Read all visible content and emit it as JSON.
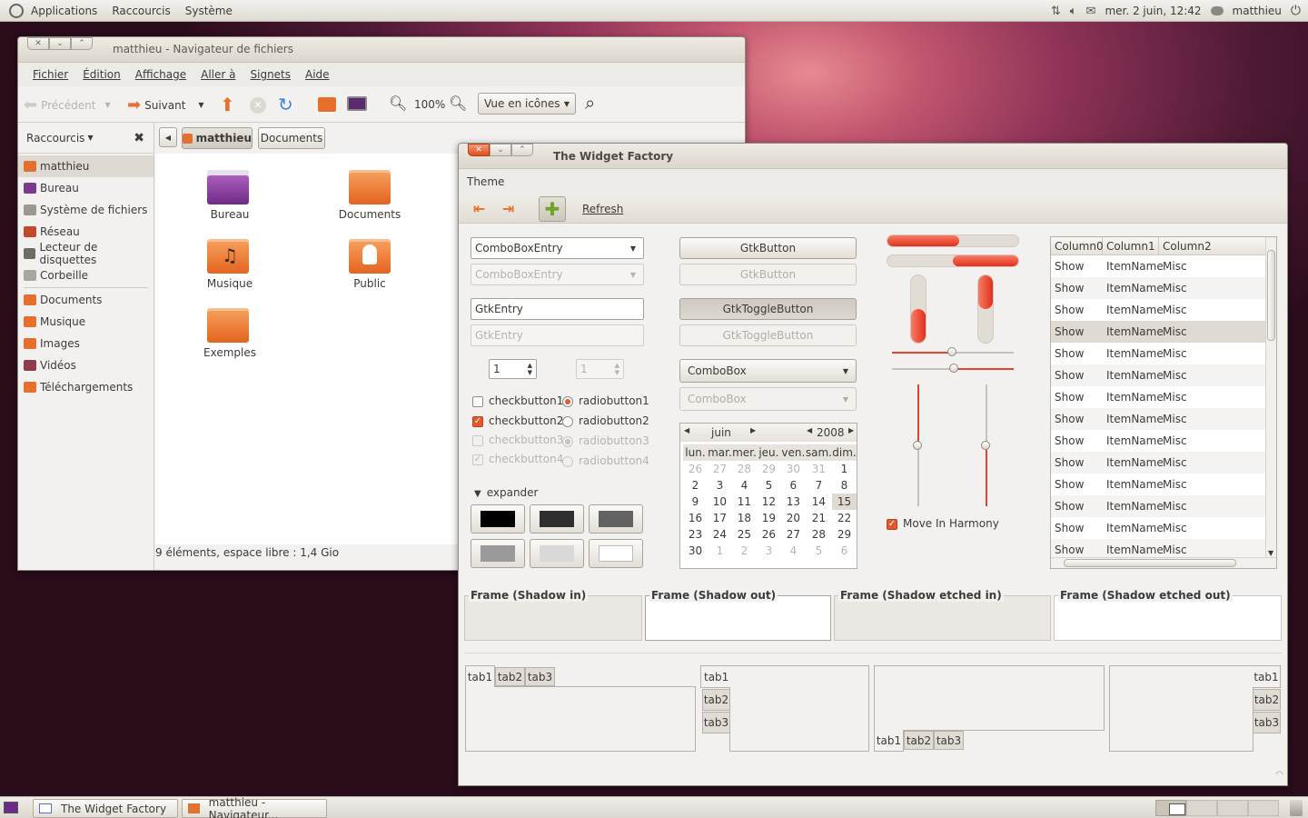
{
  "top_panel": {
    "menus": [
      "Applications",
      "Raccourcis",
      "Système"
    ],
    "datetime": "mer. 2 juin, 12:42",
    "user": "matthieu"
  },
  "nautilus": {
    "title": "matthieu - Navigateur de fichiers",
    "menus": [
      "Fichier",
      "Édition",
      "Affichage",
      "Aller à",
      "Signets",
      "Aide"
    ],
    "back": "Précédent",
    "forward": "Suivant",
    "zoom": "100%",
    "view_mode": "Vue en icônes",
    "sidebar_header": "Raccourcis",
    "path": [
      "matthieu",
      "Documents"
    ],
    "places": [
      "matthieu",
      "Bureau",
      "Système de fichiers",
      "Réseau",
      "Lecteur de disquettes",
      "Corbeille"
    ],
    "bookmarks": [
      "Documents",
      "Musique",
      "Images",
      "Vidéos",
      "Téléchargements"
    ],
    "icons": [
      "Bureau",
      "Documents",
      "Musique",
      "Public",
      "Exemples"
    ],
    "status": "9 éléments, espace libre : 1,4 Gio"
  },
  "widget_factory": {
    "title": "The Widget Factory",
    "menu": "Theme",
    "refresh": "Refresh",
    "combo_entry": "ComboBoxEntry",
    "entry": "GtkEntry",
    "spin": "1",
    "checks": [
      "checkbutton1",
      "checkbutton2",
      "checkbutton3",
      "checkbutton4"
    ],
    "radios": [
      "radiobutton1",
      "radiobutton2",
      "radiobutton3",
      "radiobutton4"
    ],
    "expander": "expander",
    "button": "GtkButton",
    "toggle": "GtkToggleButton",
    "combo": "ComboBox",
    "calendar": {
      "month": "juin",
      "year": "2008",
      "days": [
        "lun.",
        "mar.",
        "mer.",
        "jeu.",
        "ven.",
        "sam.",
        "dim."
      ],
      "weeks": [
        [
          "26",
          "27",
          "28",
          "29",
          "30",
          "31",
          "1"
        ],
        [
          "2",
          "3",
          "4",
          "5",
          "6",
          "7",
          "8"
        ],
        [
          "9",
          "10",
          "11",
          "12",
          "13",
          "14",
          "15"
        ],
        [
          "16",
          "17",
          "18",
          "19",
          "20",
          "21",
          "22"
        ],
        [
          "23",
          "24",
          "25",
          "26",
          "27",
          "28",
          "29"
        ],
        [
          "30",
          "1",
          "2",
          "3",
          "4",
          "5",
          "6"
        ]
      ]
    },
    "harmony": "Move In Harmony",
    "progress_top": 0.55,
    "progress_bottom": 0.5,
    "columns": [
      "Column0",
      "Column1",
      "Column2"
    ],
    "row": [
      "Show",
      "ItemName",
      "Misc"
    ],
    "row_count": 14,
    "frames": [
      "Frame (Shadow in)",
      "Frame (Shadow out)",
      "Frame (Shadow etched in)",
      "Frame (Shadow etched out)"
    ],
    "tabs": [
      "tab1",
      "tab2",
      "tab3"
    ]
  },
  "taskbar": [
    "The Widget Factory",
    "matthieu - Navigateur..."
  ]
}
